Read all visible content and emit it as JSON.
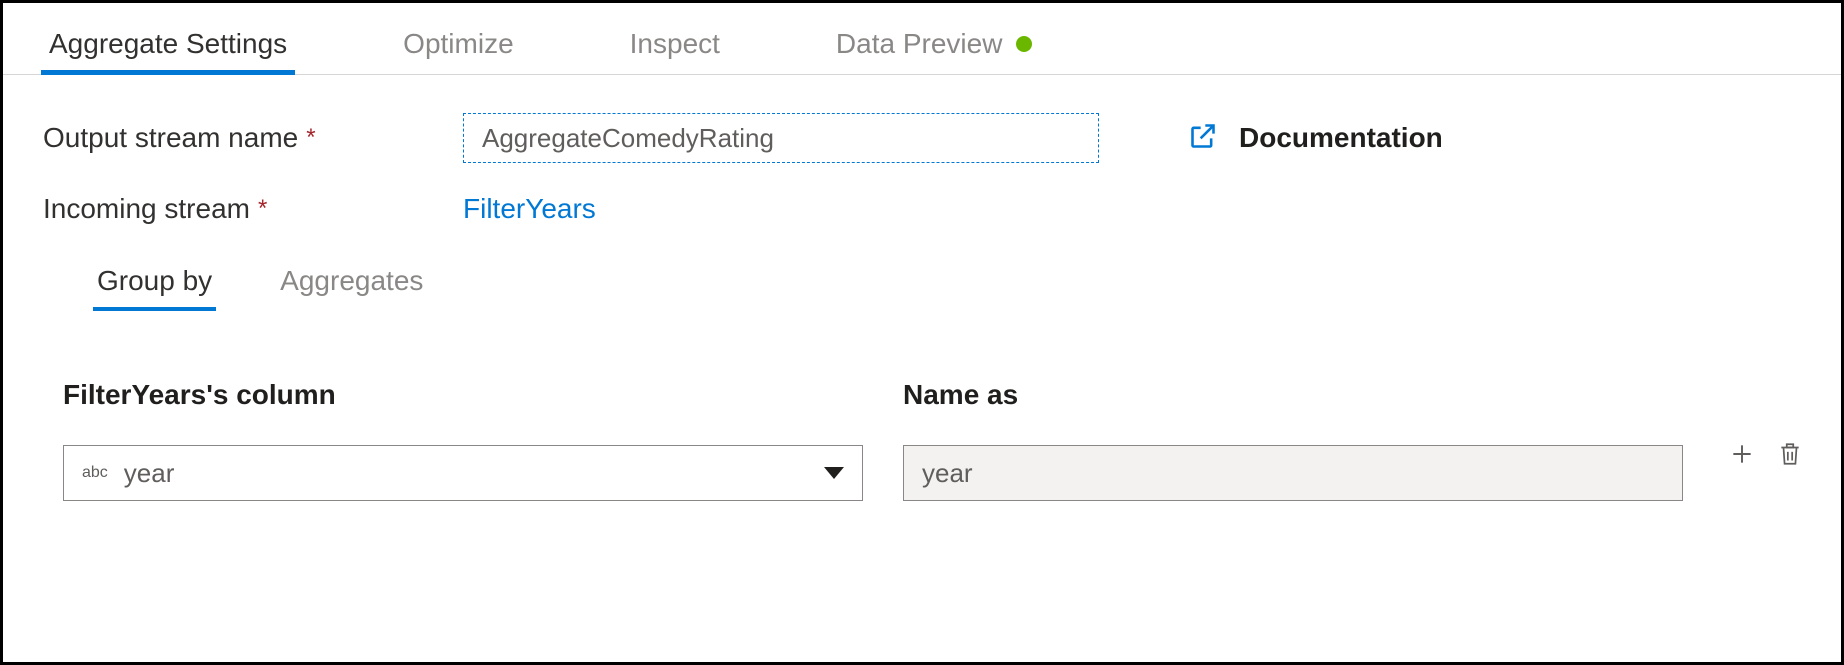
{
  "tabs": {
    "main": [
      {
        "label": "Aggregate Settings",
        "active": true
      },
      {
        "label": "Optimize",
        "active": false
      },
      {
        "label": "Inspect",
        "active": false
      },
      {
        "label": "Data Preview",
        "active": false,
        "status": "green"
      }
    ]
  },
  "fields": {
    "output_stream_label": "Output stream name",
    "output_stream_value": "AggregateComedyRating",
    "incoming_stream_label": "Incoming stream",
    "incoming_stream_value": "FilterYears",
    "documentation_label": "Documentation"
  },
  "subtabs": [
    {
      "label": "Group by",
      "active": true
    },
    {
      "label": "Aggregates",
      "active": false
    }
  ],
  "group_by": {
    "column_header": "FilterYears's column",
    "name_as_header": "Name as",
    "rows": [
      {
        "type_badge": "abc",
        "column": "year",
        "name_as": "year"
      }
    ]
  }
}
